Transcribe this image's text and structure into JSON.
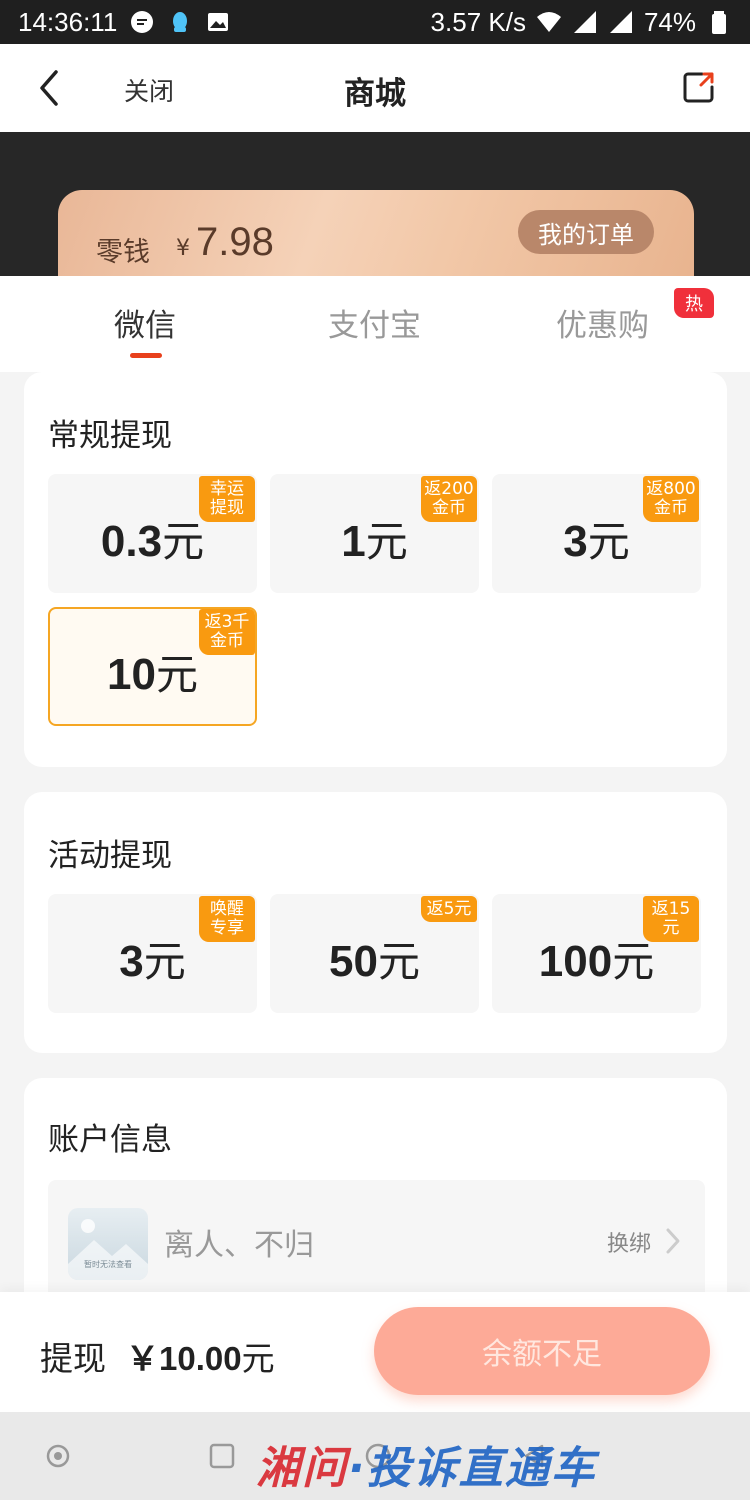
{
  "status_bar": {
    "time": "14:36:11",
    "net_speed": "3.57 K/s",
    "battery": "74%"
  },
  "nav": {
    "close_label": "关闭",
    "title": "商城"
  },
  "balance_card": {
    "label": "零钱",
    "currency": "¥",
    "amount": "7.98",
    "orders_button": "我的订单"
  },
  "tabs": [
    {
      "label": "微信",
      "active": true
    },
    {
      "label": "支付宝",
      "active": false
    },
    {
      "label": "优惠购",
      "active": false,
      "badge": "热"
    }
  ],
  "regular": {
    "title": "常规提现",
    "options": [
      {
        "amount": "0.3",
        "unit": "元",
        "badge_line1": "幸运",
        "badge_line2": "提现",
        "selected": false
      },
      {
        "amount": "1",
        "unit": "元",
        "badge_line1": "返200",
        "badge_line2": "金币",
        "selected": false
      },
      {
        "amount": "3",
        "unit": "元",
        "badge_line1": "返800",
        "badge_line2": "金币",
        "selected": false
      },
      {
        "amount": "10",
        "unit": "元",
        "badge_line1": "返3千",
        "badge_line2": "金币",
        "selected": true
      }
    ]
  },
  "activity": {
    "title": "活动提现",
    "options": [
      {
        "amount": "3",
        "unit": "元",
        "badge_line1": "唤醒",
        "badge_line2": "专享"
      },
      {
        "amount": "50",
        "unit": "元",
        "badge_line1": "返5元",
        "badge_line2": ""
      },
      {
        "amount": "100",
        "unit": "元",
        "badge_line1": "返15",
        "badge_line2": "元"
      }
    ]
  },
  "account": {
    "title": "账户信息",
    "avatar_text": "暂时无法查看",
    "name": "离人、不归",
    "rebind_label": "换绑"
  },
  "bottom": {
    "withdraw_label": "提现",
    "currency": "￥",
    "amount": "10.00",
    "unit": "元",
    "submit_label": "余额不足"
  },
  "watermark": {
    "part1": "湘问",
    "dot": "·",
    "part2": "投诉直通车"
  },
  "colors": {
    "accent": "#e8401c",
    "badge_orange": "#f99a10",
    "submit": "#fdaa97",
    "hot": "#f0303b"
  }
}
